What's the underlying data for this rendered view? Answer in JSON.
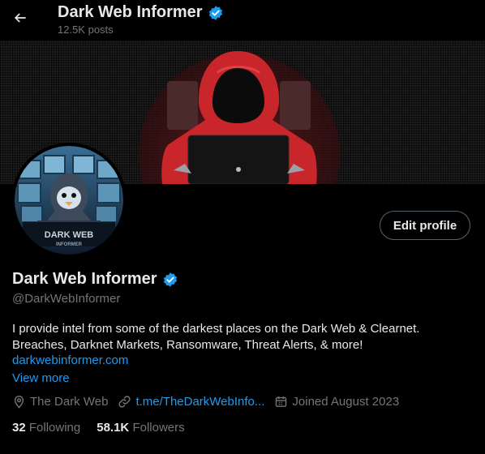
{
  "header": {
    "title": "Dark Web Informer",
    "posts": "12.5K posts"
  },
  "avatar": {
    "logo_line1": "DARK WEB",
    "logo_line2": "INFORMER"
  },
  "profile": {
    "name": "Dark Web Informer",
    "handle": "@DarkWebInformer",
    "edit_label": "Edit profile",
    "bio_line1": "I provide intel from some of the darkest places on the Dark Web & Clearnet.",
    "bio_line2": "Breaches, Darknet Markets, Ransomware, Threat Alerts, & more!",
    "website": "darkwebinformer.com",
    "view_more": "View more",
    "location": "The Dark Web",
    "link": "t.me/TheDarkWebInfo...",
    "joined": "Joined August 2023",
    "following_count": "32",
    "following_label": "Following",
    "followers_count": "58.1K",
    "followers_label": "Followers"
  },
  "colors": {
    "background": "#000000",
    "accent": "#1d9bf0",
    "verified": "#1d9bf0",
    "secondary_text": "#71767b",
    "hood_red": "#c8262b"
  },
  "icons": [
    "back-arrow-icon",
    "verified-badge-icon",
    "location-icon",
    "link-icon",
    "calendar-icon"
  ]
}
